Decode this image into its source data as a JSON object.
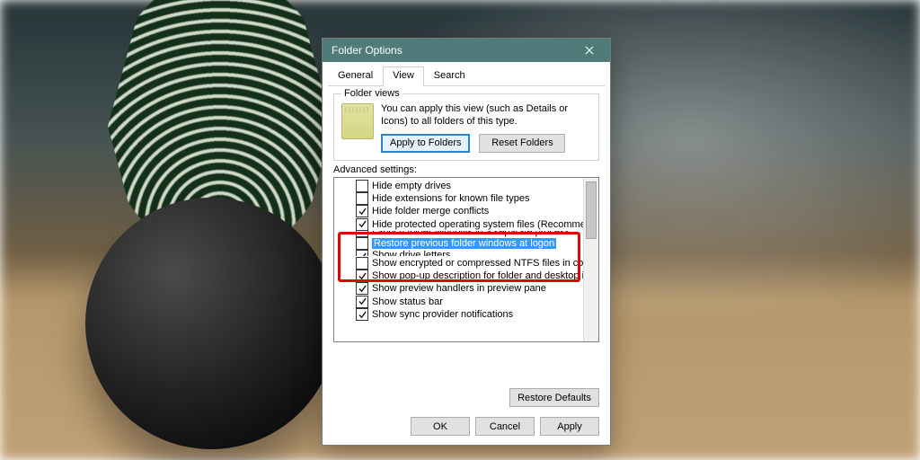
{
  "window": {
    "title": "Folder Options"
  },
  "tabs": {
    "general": "General",
    "view": "View",
    "search": "Search"
  },
  "folderViews": {
    "legend": "Folder views",
    "text": "You can apply this view (such as Details or Icons) to all folders of this type.",
    "apply": "Apply to Folders",
    "reset": "Reset Folders"
  },
  "advanced": {
    "label": "Advanced settings:",
    "items": [
      {
        "checked": false,
        "label": "Hide empty drives"
      },
      {
        "checked": false,
        "label": "Hide extensions for known file types"
      },
      {
        "checked": true,
        "label": "Hide folder merge conflicts"
      },
      {
        "checked": true,
        "label": "Hide protected operating system files (Recommended)"
      },
      {
        "checked": false,
        "label": "Launch folder windows in a separate process",
        "truncTop": true
      },
      {
        "checked": false,
        "label": "Restore previous folder windows at logon",
        "selected": true
      },
      {
        "checked": true,
        "label": "Show drive letters",
        "truncBot": true
      },
      {
        "checked": false,
        "label": "Show encrypted or compressed NTFS files in color"
      },
      {
        "checked": true,
        "label": "Show pop-up description for folder and desktop items"
      },
      {
        "checked": true,
        "label": "Show preview handlers in preview pane"
      },
      {
        "checked": true,
        "label": "Show status bar"
      },
      {
        "checked": true,
        "label": "Show sync provider notifications"
      }
    ]
  },
  "buttons": {
    "restore": "Restore Defaults",
    "ok": "OK",
    "cancel": "Cancel",
    "apply": "Apply"
  }
}
